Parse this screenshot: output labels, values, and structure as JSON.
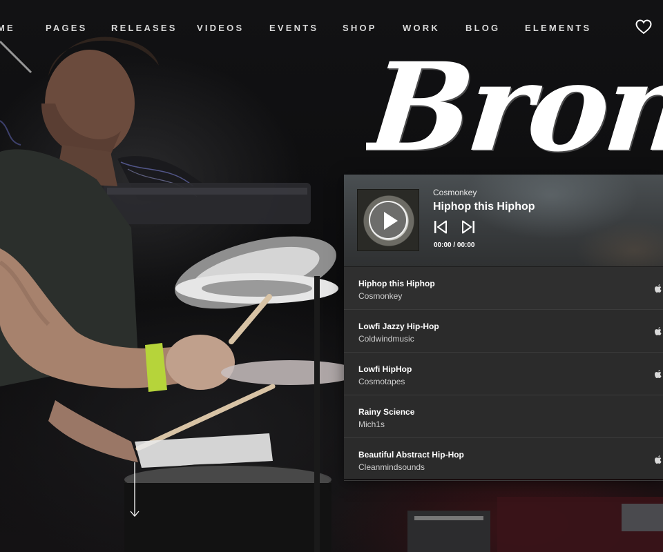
{
  "nav": {
    "items": [
      {
        "label": "ME"
      },
      {
        "label": "PAGES"
      },
      {
        "label": "RELEASES"
      },
      {
        "label": "VIDEOS"
      },
      {
        "label": "EVENTS"
      },
      {
        "label": "SHOP"
      },
      {
        "label": "WORK"
      },
      {
        "label": "BLOG"
      },
      {
        "label": "ELEMENTS"
      }
    ],
    "wishlist_icon": "heart-icon"
  },
  "hero": {
    "title": "Bronz"
  },
  "player": {
    "now_playing": {
      "artist": "Cosmonkey",
      "title": "Hiphop this Hiphop",
      "time": "00:00 / 00:00"
    },
    "controls": [
      "previous-icon",
      "next-icon",
      "play-icon"
    ],
    "tracks": [
      {
        "title": "Hiphop this Hiphop",
        "artist": "Cosmonkey",
        "icon": "apple-icon"
      },
      {
        "title": "Lowfi Jazzy Hip-Hop",
        "artist": "Coldwindmusic",
        "icon": "apple-icon"
      },
      {
        "title": "Lowfi HipHop",
        "artist": "Cosmotapes",
        "icon": "apple-icon"
      },
      {
        "title": "Rainy Science",
        "artist": "Mich1s",
        "icon": ""
      },
      {
        "title": "Beautiful Abstract Hip-Hop",
        "artist": "Cleanmindsounds",
        "icon": "apple-icon"
      }
    ]
  },
  "scroll_icon": "arrow-down-icon",
  "colors": {
    "panel": "#2b2b2b",
    "text": "#ffffff",
    "muted": "#cfcfcf"
  }
}
